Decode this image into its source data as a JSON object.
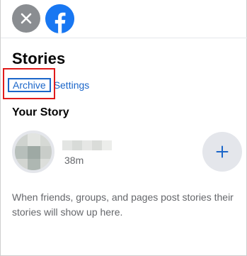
{
  "header": {
    "close_icon": "close-icon",
    "logo_icon": "facebook-logo-icon",
    "brand_color": "#1877f2"
  },
  "stories": {
    "title": "Stories",
    "archive_label": "Archive",
    "settings_label": "Settings",
    "link_color": "#1b66c9",
    "highlight_color": "#e01b1b"
  },
  "your_story": {
    "heading": "Your Story",
    "time": "38m",
    "add_icon": "plus-icon"
  },
  "empty_message": "When friends, groups, and pages post stories their stories will show up here."
}
